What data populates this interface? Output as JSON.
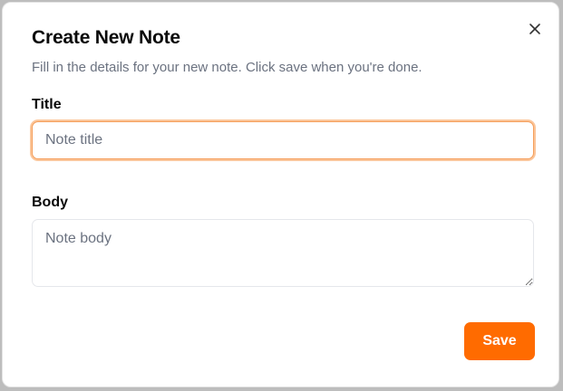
{
  "dialog": {
    "title": "Create New Note",
    "description": "Fill in the details for your new note. Click save when you're done.",
    "close_icon": "close-icon"
  },
  "form": {
    "title_label": "Title",
    "title_value": "",
    "title_placeholder": "Note title",
    "body_label": "Body",
    "body_value": "",
    "body_placeholder": "Note body"
  },
  "actions": {
    "save_label": "Save"
  },
  "colors": {
    "accent": "#ff6b00",
    "focus_ring": "#fbc69b",
    "muted_text": "#6b7280"
  }
}
